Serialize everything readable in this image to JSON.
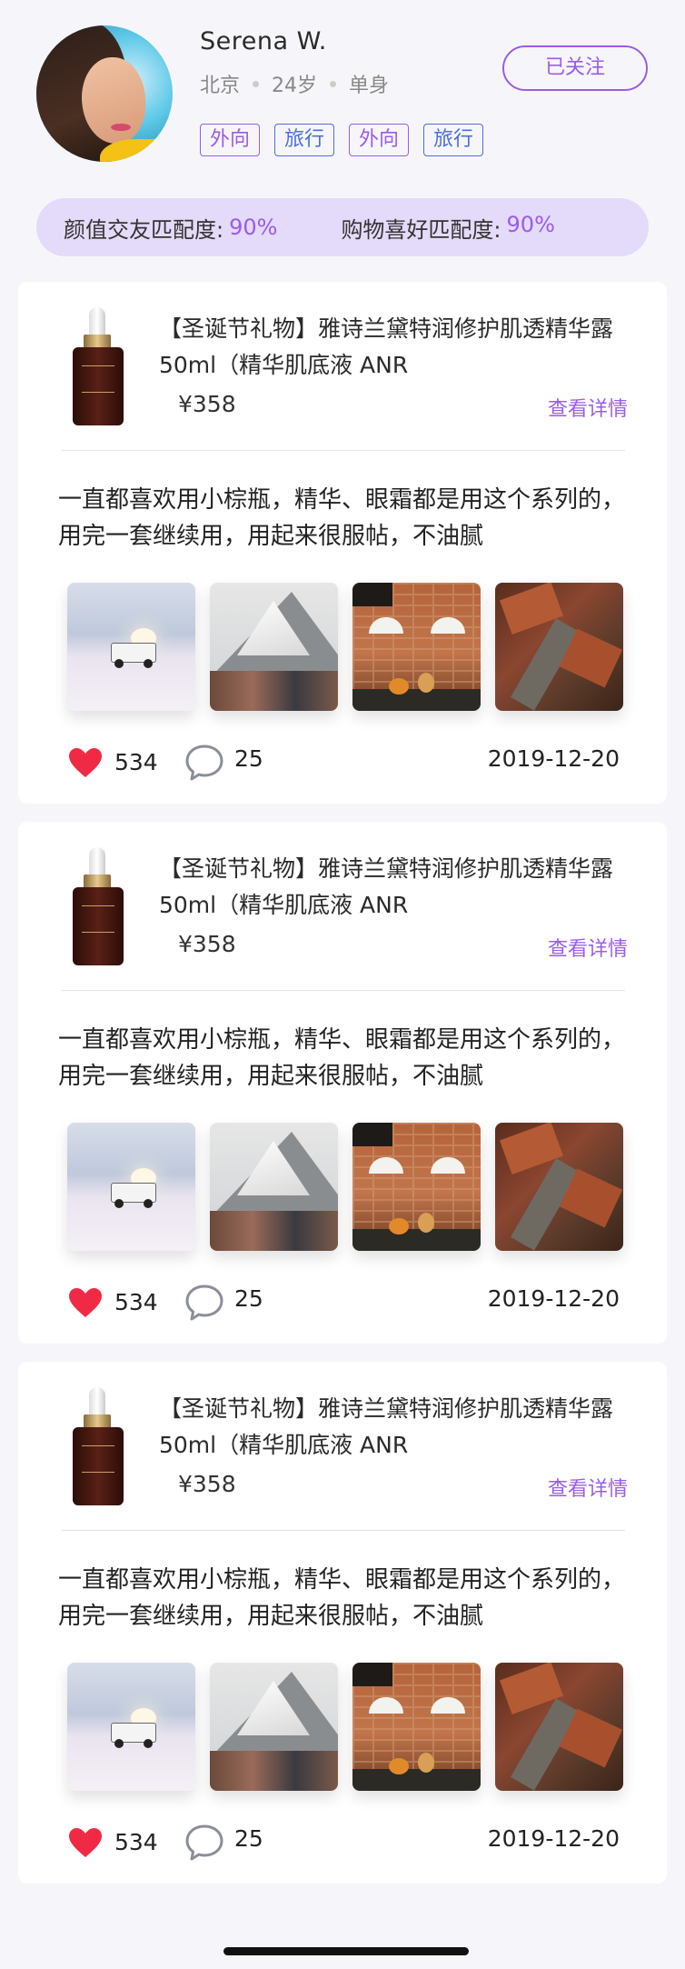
{
  "profile": {
    "name": "Serena W.",
    "city": "北京",
    "age": "24岁",
    "relationship": "单身",
    "tags": [
      {
        "label": "外向",
        "color": "#9a5ce8"
      },
      {
        "label": "旅行",
        "color": "#4a6fe0"
      },
      {
        "label": "外向",
        "color": "#9a5ce8"
      },
      {
        "label": "旅行",
        "color": "#4a6fe0"
      }
    ],
    "follow_label": "已关注"
  },
  "match": {
    "looks_label": "颜值交友匹配度:",
    "looks_value": "90%",
    "shopping_label": "购物喜好匹配度:",
    "shopping_value": "90%"
  },
  "posts": [
    {
      "product_title": "【圣诞节礼物】雅诗兰黛特润修护肌透精华露 50ml（精华肌底液 ANR",
      "price": "¥358",
      "detail_label": "查看详情",
      "review": "一直都喜欢用小棕瓶，精华、眼霜都是用这个系列的，用完一套继续用，用起来很服帖，不油腻",
      "likes": "534",
      "comments": "25",
      "date": "2019-12-20"
    },
    {
      "product_title": "【圣诞节礼物】雅诗兰黛特润修护肌透精华露 50ml（精华肌底液 ANR",
      "price": "¥358",
      "detail_label": "查看详情",
      "review": "一直都喜欢用小棕瓶，精华、眼霜都是用这个系列的，用完一套继续用，用起来很服帖，不油腻",
      "likes": "534",
      "comments": "25",
      "date": "2019-12-20"
    },
    {
      "product_title": "【圣诞节礼物】雅诗兰黛特润修护肌透精华露 50ml（精华肌底液 ANR",
      "price": "¥358",
      "detail_label": "查看详情",
      "review": "一直都喜欢用小棕瓶，精华、眼霜都是用这个系列的，用完一套继续用，用起来很服帖，不油腻",
      "likes": "534",
      "comments": "25",
      "date": "2019-12-20"
    }
  ],
  "colors": {
    "accent": "#9a5ce8",
    "like": "#f02a45",
    "match_bg": "#e4daf9"
  }
}
